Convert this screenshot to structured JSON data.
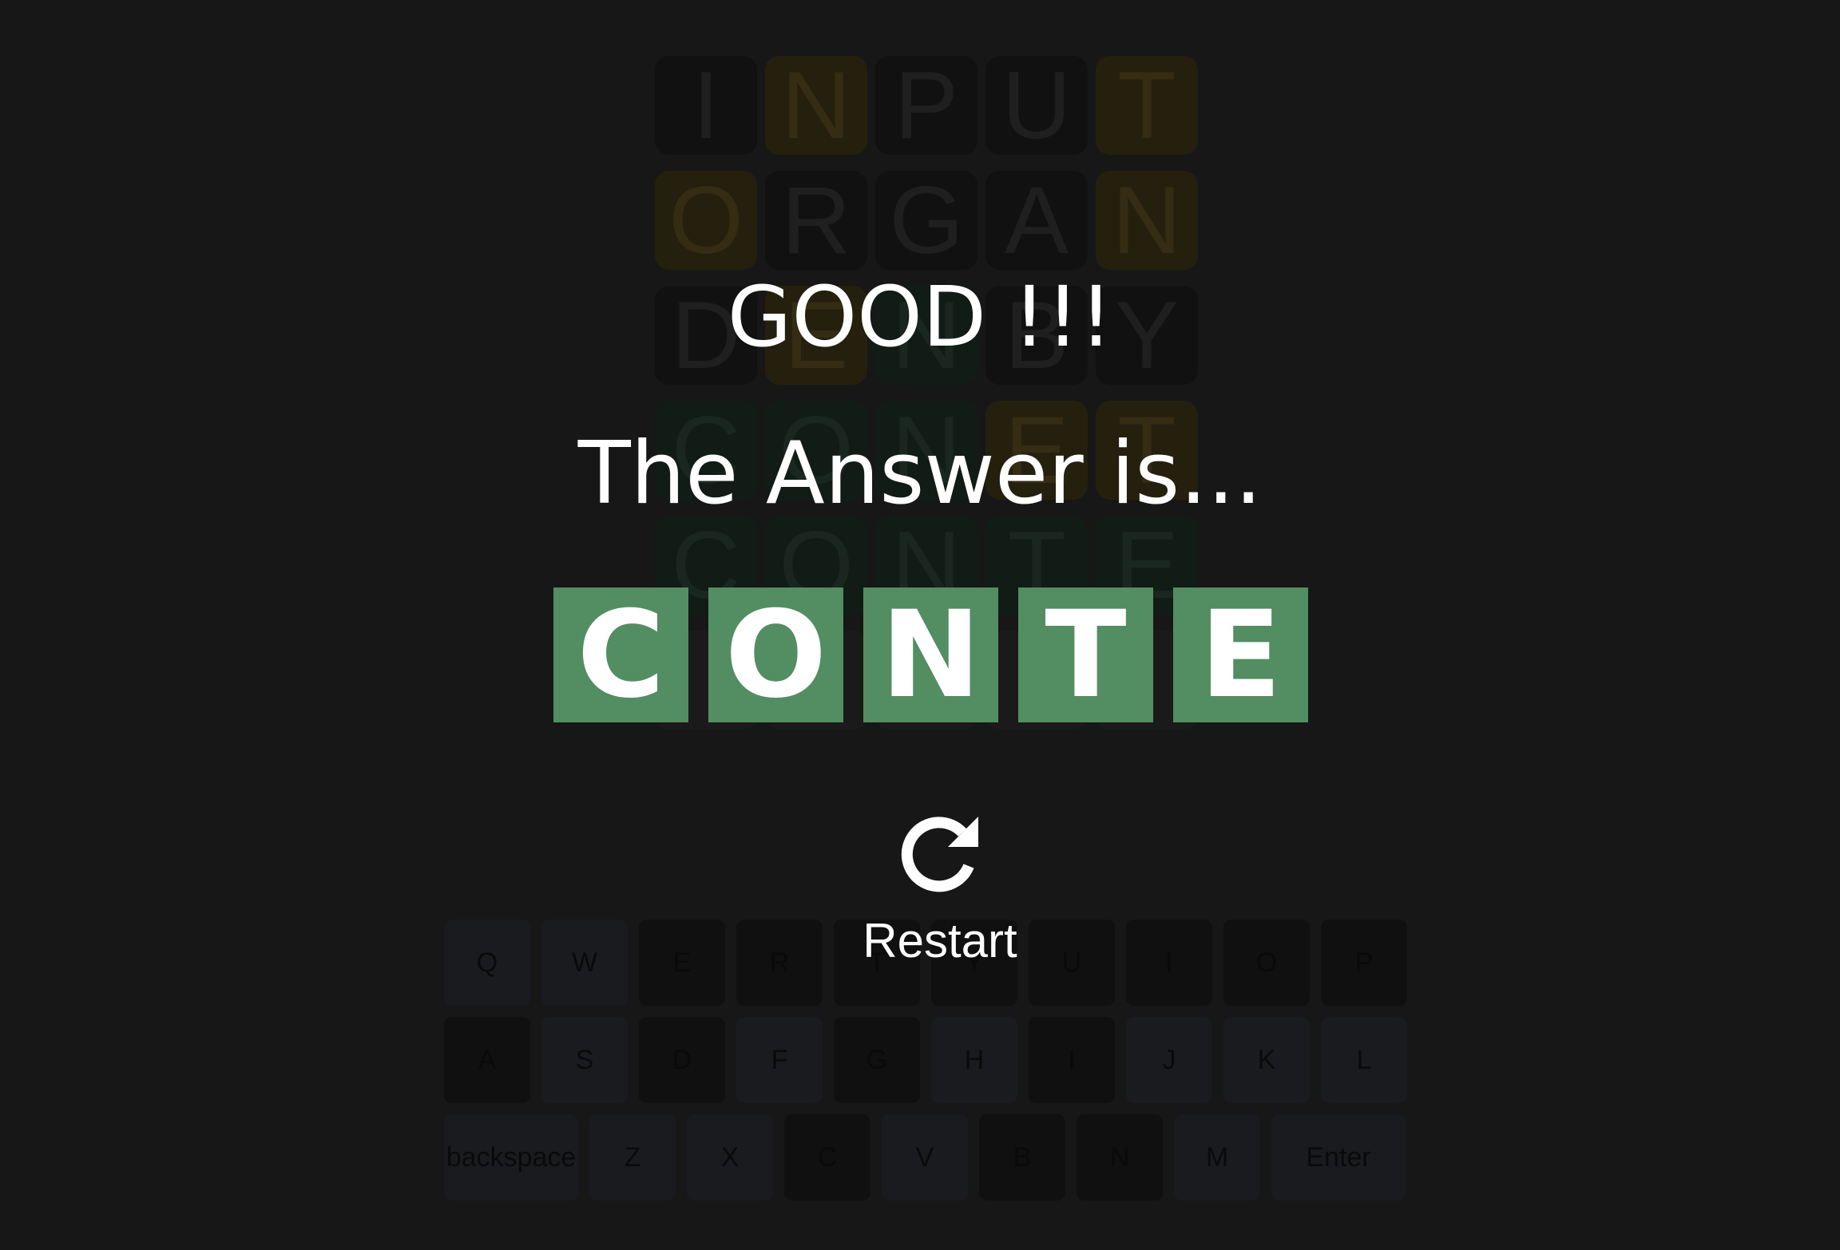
{
  "board": {
    "rows": [
      [
        {
          "l": "I",
          "s": "absent"
        },
        {
          "l": "N",
          "s": "present"
        },
        {
          "l": "P",
          "s": "absent"
        },
        {
          "l": "U",
          "s": "absent"
        },
        {
          "l": "T",
          "s": "present"
        }
      ],
      [
        {
          "l": "O",
          "s": "present"
        },
        {
          "l": "R",
          "s": "absent"
        },
        {
          "l": "G",
          "s": "absent"
        },
        {
          "l": "A",
          "s": "absent"
        },
        {
          "l": "N",
          "s": "present"
        }
      ],
      [
        {
          "l": "D",
          "s": "absent"
        },
        {
          "l": "E",
          "s": "present"
        },
        {
          "l": "N",
          "s": "correct"
        },
        {
          "l": "B",
          "s": "absent"
        },
        {
          "l": "Y",
          "s": "absent"
        }
      ],
      [
        {
          "l": "C",
          "s": "correct"
        },
        {
          "l": "O",
          "s": "correct"
        },
        {
          "l": "N",
          "s": "correct"
        },
        {
          "l": "E",
          "s": "present"
        },
        {
          "l": "T",
          "s": "present"
        }
      ],
      [
        {
          "l": "C",
          "s": "correct"
        },
        {
          "l": "O",
          "s": "correct"
        },
        {
          "l": "N",
          "s": "correct"
        },
        {
          "l": "T",
          "s": "correct"
        },
        {
          "l": "E",
          "s": "correct"
        }
      ],
      [
        {
          "l": "",
          "s": "empty"
        },
        {
          "l": "",
          "s": "empty"
        },
        {
          "l": "",
          "s": "empty"
        },
        {
          "l": "",
          "s": "empty"
        },
        {
          "l": "",
          "s": "empty"
        }
      ]
    ]
  },
  "keyboard": {
    "rows": [
      [
        {
          "k": "Q"
        },
        {
          "k": "W"
        },
        {
          "k": "E",
          "used": true
        },
        {
          "k": "R",
          "used": true
        },
        {
          "k": "T",
          "used": true
        },
        {
          "k": "Y",
          "used": true
        },
        {
          "k": "U",
          "used": true
        },
        {
          "k": "I",
          "used": true
        },
        {
          "k": "O",
          "used": true
        },
        {
          "k": "P",
          "used": true
        }
      ],
      [
        {
          "k": "A",
          "used": true
        },
        {
          "k": "S"
        },
        {
          "k": "D",
          "used": true
        },
        {
          "k": "F"
        },
        {
          "k": "G",
          "used": true
        },
        {
          "k": "H"
        },
        {
          "k": "I",
          "used": true
        },
        {
          "k": "J"
        },
        {
          "k": "K"
        },
        {
          "k": "L"
        }
      ],
      [
        {
          "k": "backspace",
          "wide": true
        },
        {
          "k": "Z"
        },
        {
          "k": "X"
        },
        {
          "k": "C",
          "used": true
        },
        {
          "k": "V"
        },
        {
          "k": "B",
          "used": true
        },
        {
          "k": "N",
          "used": true
        },
        {
          "k": "M"
        },
        {
          "k": "Enter",
          "wide": true
        }
      ]
    ]
  },
  "result": {
    "title": "GOOD !!!",
    "caption": "The Answer is...",
    "answer": [
      "C",
      "O",
      "N",
      "T",
      "E"
    ],
    "tile_color": "#538d62"
  },
  "restart": {
    "icon": "restart-icon",
    "label": "Restart"
  }
}
